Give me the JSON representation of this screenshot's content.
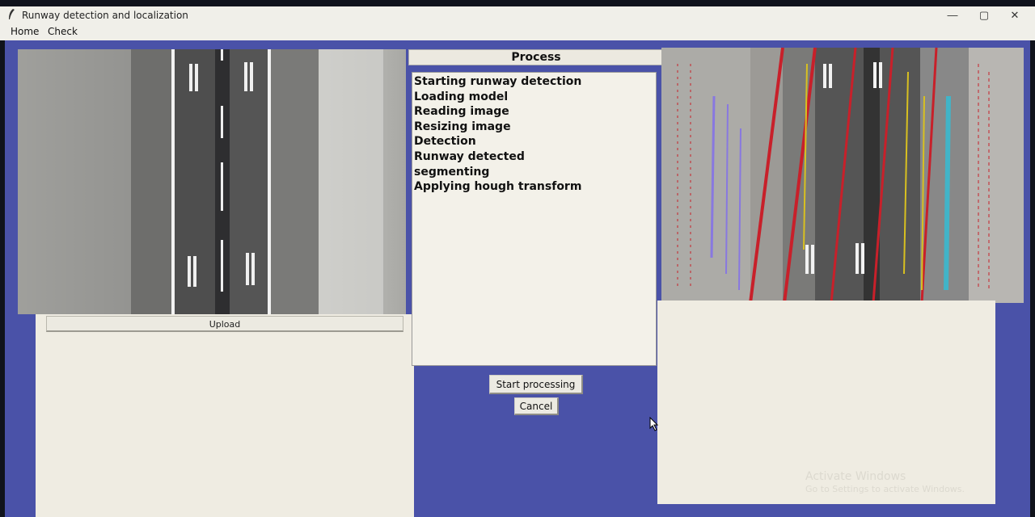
{
  "window": {
    "title": "Runway detection and localization",
    "controls": {
      "minimize": "—",
      "maximize": "▢",
      "close": "✕"
    }
  },
  "menu": {
    "home": "Home",
    "check": "Check"
  },
  "left": {
    "upload_label": "Upload"
  },
  "center": {
    "header": "Process",
    "log": [
      "Starting runway detection",
      "Loading model",
      "Reading image",
      "Resizing image",
      "Detection",
      "Runway detected",
      "segmenting",
      "Applying hough transform"
    ],
    "start_label": "Start processing",
    "cancel_label": "Cancel"
  },
  "watermark": {
    "line1": "Activate Windows",
    "line2": "Go to Settings to activate Windows."
  },
  "colors": {
    "app_background": "#4a52a8",
    "panel": "#efece2",
    "overlay_red": "#c8202a",
    "overlay_yellow": "#d8c020",
    "overlay_cyan": "#30c0d8",
    "overlay_purple": "#8878e0"
  }
}
